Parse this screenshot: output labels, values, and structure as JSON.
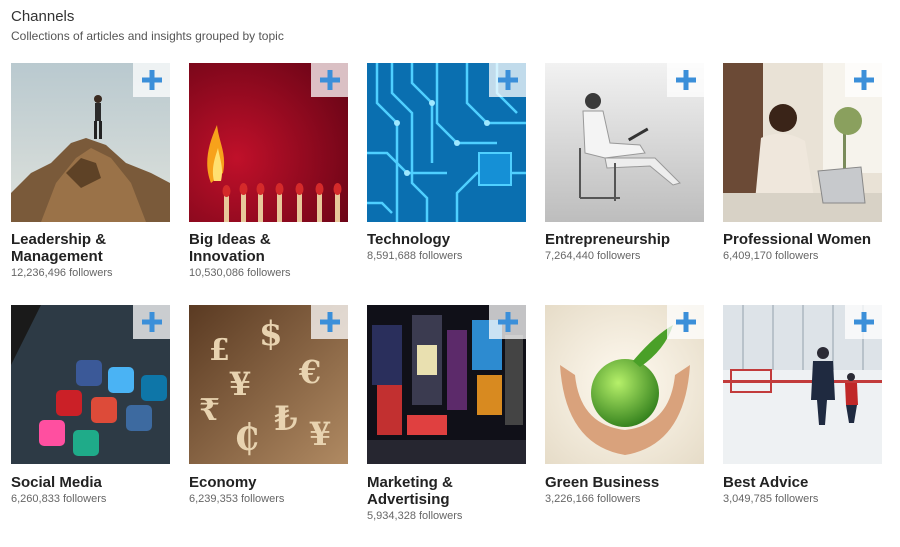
{
  "header": {
    "title": "Channels",
    "subtitle": "Collections of articles and insights grouped by topic"
  },
  "accent": "#3b8fd9",
  "channels": [
    {
      "name": "Leadership & Management",
      "followers": "12,236,496 followers"
    },
    {
      "name": "Big Ideas & Innovation",
      "followers": "10,530,086 followers"
    },
    {
      "name": "Technology",
      "followers": "8,591,688 followers"
    },
    {
      "name": "Entrepreneurship",
      "followers": "7,264,440 followers"
    },
    {
      "name": "Professional Women",
      "followers": "6,409,170 followers"
    },
    {
      "name": "Social Media",
      "followers": "6,260,833 followers"
    },
    {
      "name": "Economy",
      "followers": "6,239,353 followers"
    },
    {
      "name": "Marketing & Advertising",
      "followers": "5,934,328 followers"
    },
    {
      "name": "Green Business",
      "followers": "3,226,166 followers"
    },
    {
      "name": "Best Advice",
      "followers": "3,049,785 followers"
    }
  ]
}
